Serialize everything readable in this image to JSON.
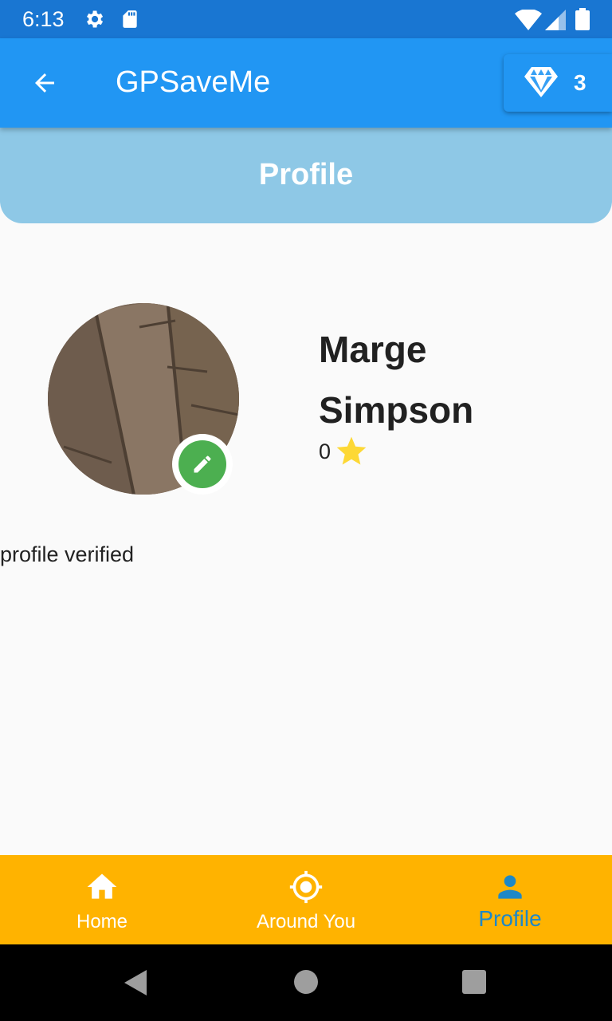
{
  "status_bar": {
    "time": "6:13",
    "icons": [
      "settings-icon",
      "sd-card-icon",
      "wifi-icon",
      "signal-icon",
      "battery-icon"
    ]
  },
  "app_bar": {
    "title": "GPSaveMe",
    "back_icon": "arrow-back-icon",
    "gems": {
      "icon": "diamond-icon",
      "count": "3"
    }
  },
  "header": {
    "title": "Profile"
  },
  "profile": {
    "first_name": "Marge",
    "last_name": "Simpson",
    "rating": "0",
    "rating_icon": "star-icon",
    "verified_text": "profile verified",
    "edit_icon": "pencil-icon"
  },
  "bottom_nav": {
    "items": [
      {
        "label": "Home",
        "icon": "home-icon",
        "active": false
      },
      {
        "label": "Around You",
        "icon": "gps-target-icon",
        "active": false
      },
      {
        "label": "Profile",
        "icon": "person-icon",
        "active": true
      }
    ]
  },
  "colors": {
    "status_bar": "#1976d2",
    "app_bar": "#2196f3",
    "header": "#8ec8e6",
    "bottom_nav": "#ffb300",
    "active_tab": "#1e88c7",
    "edit_badge": "#4caf50",
    "star": "#fdd835"
  }
}
